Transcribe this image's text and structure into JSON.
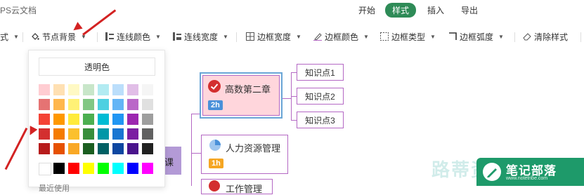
{
  "app": {
    "title": "PS云文档"
  },
  "tabs": [
    {
      "label": "开始",
      "active": false
    },
    {
      "label": "样式",
      "active": true
    },
    {
      "label": "插入",
      "active": false
    },
    {
      "label": "导出",
      "active": false
    }
  ],
  "toolbar": {
    "style_tail": "样式",
    "node_bg": "节点背景",
    "line_color": "连线颜色",
    "line_width": "连线宽度",
    "border_width": "边框宽度",
    "border_color": "边框颜色",
    "border_type": "边框类型",
    "border_radius": "边框弧度",
    "clear_style": "清除样式"
  },
  "dropdown": {
    "transparent_label": "透明色",
    "recent_label": "最近使用",
    "palette_rows": [
      [
        "#ffcdd2",
        "#ffe0b2",
        "#fff9c4",
        "#c8e6c9",
        "#b2ebf2",
        "#bbdefb",
        "#e1bee7",
        "#f5f5f5"
      ],
      [
        "#e57373",
        "#ffb74d",
        "#fff176",
        "#81c784",
        "#4dd0e1",
        "#64b5f6",
        "#ba68c8",
        "#e0e0e0"
      ],
      [
        "#f44336",
        "#ff9800",
        "#ffeb3b",
        "#4caf50",
        "#00bcd4",
        "#2196f3",
        "#9c27b0",
        "#9e9e9e"
      ],
      [
        "#d32f2f",
        "#f57c00",
        "#fbc02d",
        "#388e3c",
        "#0097a7",
        "#1976d2",
        "#7b1fa2",
        "#616161"
      ],
      [
        "#b71c1c",
        "#e65100",
        "#f9a825",
        "#1b5e20",
        "#006064",
        "#0d47a1",
        "#4a148c",
        "#212121"
      ]
    ],
    "basic_row": [
      "#ffffff",
      "#000000",
      "#ff0000",
      "#ffff00",
      "#00ff00",
      "#00ffff",
      "#0000ff",
      "#ff00ff"
    ]
  },
  "mindmap": {
    "root_partial": "课",
    "nodes": [
      {
        "label": "高数第二章",
        "badge": "2h",
        "icon": "check-circle-icon",
        "bg": "#ffd6dc"
      },
      {
        "label": "人力资源管理",
        "badge": "1h",
        "icon": "quarter-pie-icon",
        "bg": "#ffffff"
      },
      {
        "label": "工作管理",
        "badge": "",
        "icon": "red-circle-icon",
        "bg": "#ffffff"
      }
    ],
    "knowledge_points": [
      "知识点1",
      "知识点2",
      "知识点3"
    ]
  },
  "watermark": {
    "text": "路蒂资源网",
    "brand": "笔记部落",
    "url": "www.notetribe.com"
  },
  "colors": {
    "accent": "#2e8b57",
    "border_purple": "#b468c4",
    "badge_yellow": "#f5a623",
    "arrow_red": "#d32222"
  }
}
